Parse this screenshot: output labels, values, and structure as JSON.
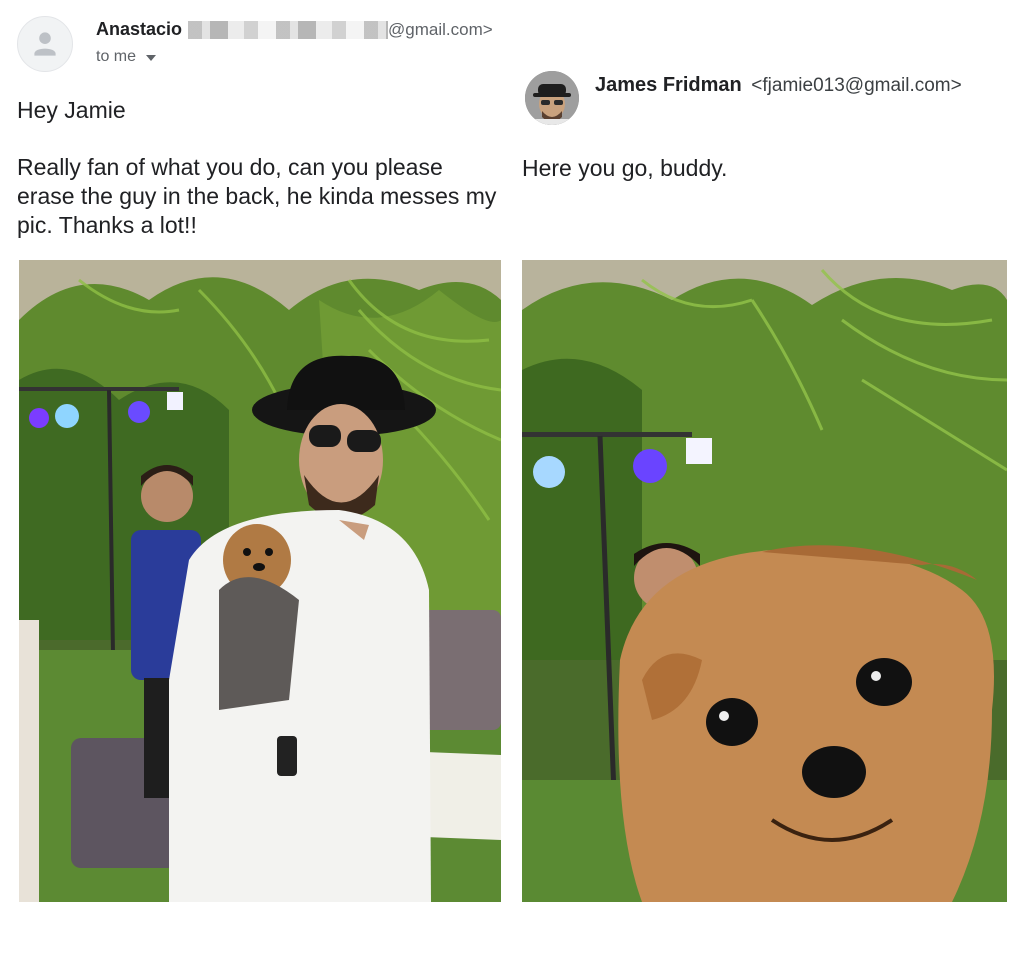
{
  "left_email": {
    "sender_name": "Anastacio",
    "sender_email_suffix": "@gmail.com>",
    "recipient": "to me",
    "greeting": "Hey Jamie",
    "body": "Really fan of what you do, can you please erase the guy in the back, he kinda messes my pic. Thanks a lot!!"
  },
  "right_email": {
    "sender_name": "James Fridman",
    "sender_email": "<fjamie013@gmail.com>",
    "reply": "Here you go, buddy."
  },
  "photos": {
    "left_description_icon": "man-with-dog-photo",
    "right_description_icon": "dog-closeup-photo"
  },
  "colors": {
    "text": "#202124",
    "secondary_text": "#5f6368"
  }
}
